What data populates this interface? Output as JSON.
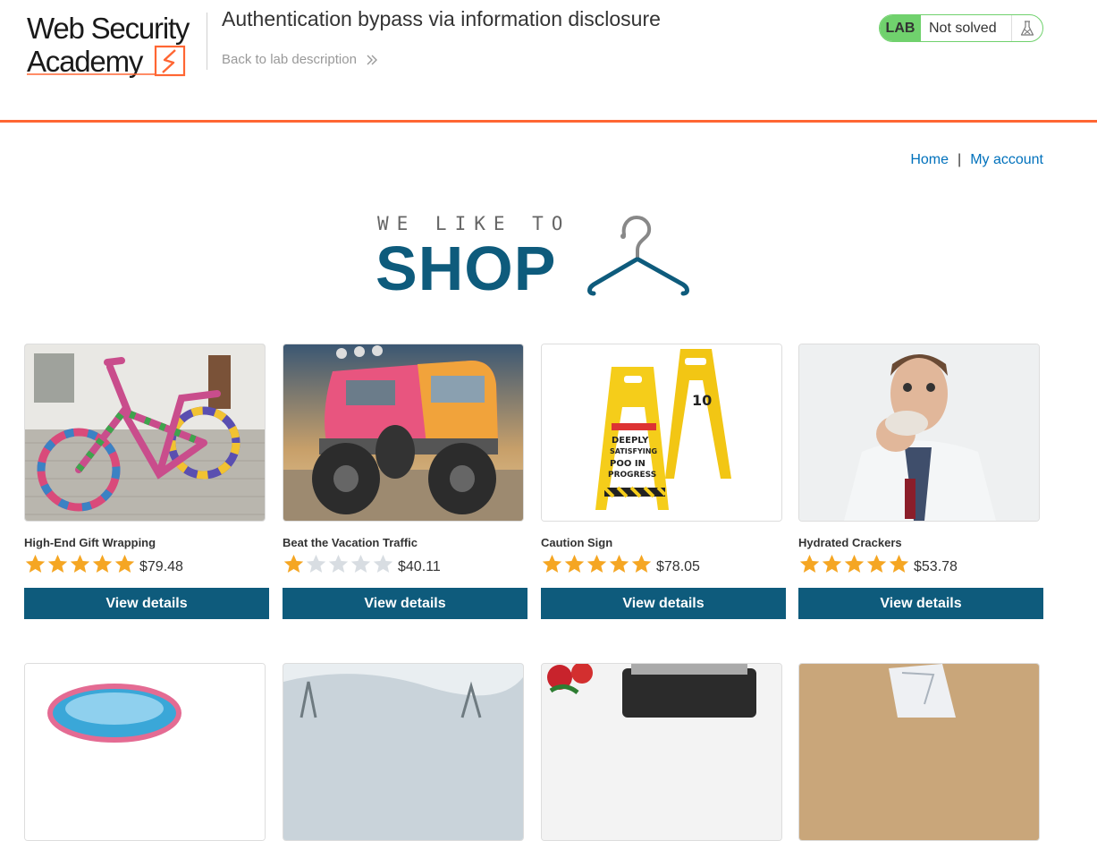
{
  "header": {
    "logo_text": [
      "Web Security",
      "Academy"
    ],
    "lab_title": "Authentication bypass via information disclosure",
    "back_link": "Back to lab description",
    "status": {
      "badge": "LAB",
      "text": "Not solved",
      "icon": "flask-icon"
    }
  },
  "nav": {
    "home": "Home",
    "separator": "|",
    "account": "My account"
  },
  "banner": {
    "top": "WE LIKE TO",
    "main": "SHOP",
    "icon": "hanger-icon"
  },
  "colors": {
    "accent": "#ff6633",
    "primary": "#0e5b7c",
    "status_green": "#70d16d",
    "star": "#f5a623",
    "link": "#0071bc"
  },
  "products": [
    {
      "name": "High-End Gift Wrapping",
      "rating": 5,
      "price": "$79.48",
      "button": "View details"
    },
    {
      "name": "Beat the Vacation Traffic",
      "rating": 1,
      "price": "$40.11",
      "button": "View details"
    },
    {
      "name": "Caution Sign",
      "rating": 5,
      "price": "$78.05",
      "button": "View details"
    },
    {
      "name": "Hydrated Crackers",
      "rating": 5,
      "price": "$53.78",
      "button": "View details"
    }
  ]
}
